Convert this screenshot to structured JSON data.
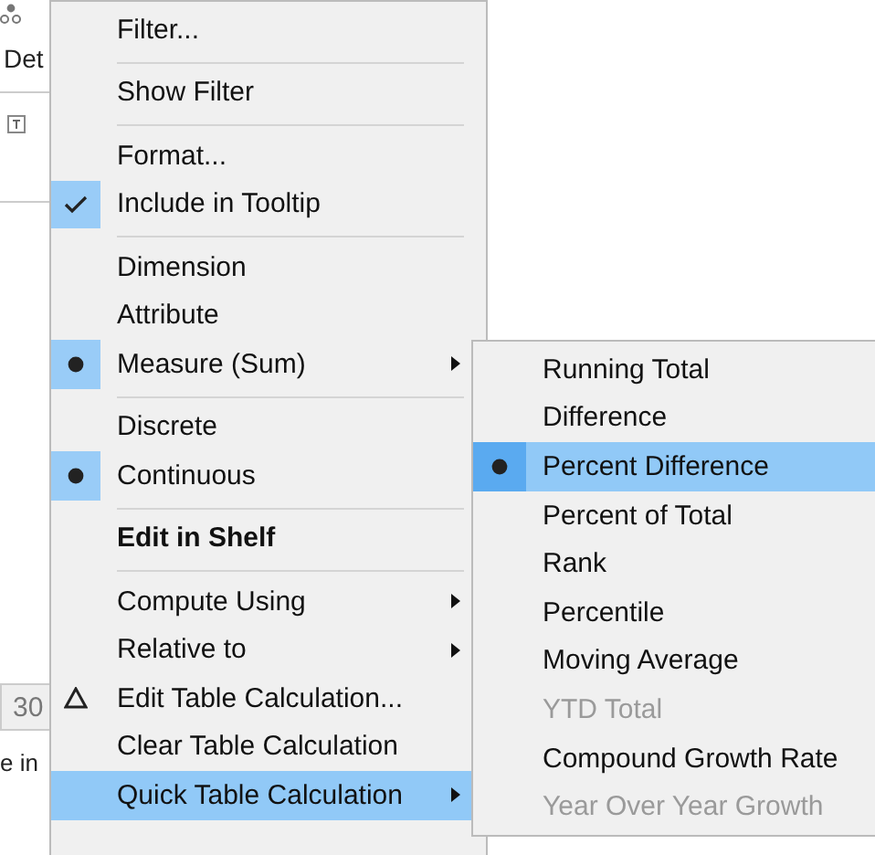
{
  "background": {
    "shelf_label": "Det",
    "cell_value": "30",
    "caption": "e in"
  },
  "menu": {
    "groups": [
      [
        {
          "label": "Filter...",
          "kind": "plain",
          "submenu": false,
          "bold": false,
          "highlighted": false
        }
      ],
      [
        {
          "label": "Show Filter",
          "kind": "plain",
          "submenu": false,
          "bold": false,
          "highlighted": false
        }
      ],
      [
        {
          "label": "Format...",
          "kind": "plain",
          "submenu": false,
          "bold": false,
          "highlighted": false
        },
        {
          "label": "Include in Tooltip",
          "kind": "check",
          "submenu": false,
          "bold": false,
          "highlighted": false
        }
      ],
      [
        {
          "label": "Dimension",
          "kind": "plain",
          "submenu": false,
          "bold": false,
          "highlighted": false
        },
        {
          "label": "Attribute",
          "kind": "plain",
          "submenu": false,
          "bold": false,
          "highlighted": false
        },
        {
          "label": "Measure (Sum)",
          "kind": "bullet",
          "submenu": true,
          "bold": false,
          "highlighted": false
        }
      ],
      [
        {
          "label": "Discrete",
          "kind": "plain",
          "submenu": false,
          "bold": false,
          "highlighted": false
        },
        {
          "label": "Continuous",
          "kind": "bullet",
          "submenu": false,
          "bold": false,
          "highlighted": false
        }
      ],
      [
        {
          "label": "Edit in Shelf",
          "kind": "plain",
          "submenu": false,
          "bold": true,
          "highlighted": false
        }
      ],
      [
        {
          "label": "Compute Using",
          "kind": "plain",
          "submenu": true,
          "bold": false,
          "highlighted": false
        },
        {
          "label": "Relative to",
          "kind": "plain",
          "submenu": true,
          "bold": false,
          "highlighted": false
        },
        {
          "label": "Edit Table Calculation...",
          "kind": "delta",
          "submenu": false,
          "bold": false,
          "highlighted": false
        },
        {
          "label": "Clear Table Calculation",
          "kind": "plain",
          "submenu": false,
          "bold": false,
          "highlighted": false
        },
        {
          "label": "Quick Table Calculation",
          "kind": "plain",
          "submenu": true,
          "bold": false,
          "highlighted": true
        }
      ]
    ]
  },
  "submenu": {
    "items": [
      {
        "label": "Running Total",
        "selected": false,
        "disabled": false
      },
      {
        "label": "Difference",
        "selected": false,
        "disabled": false
      },
      {
        "label": "Percent Difference",
        "selected": true,
        "disabled": false
      },
      {
        "label": "Percent of Total",
        "selected": false,
        "disabled": false
      },
      {
        "label": "Rank",
        "selected": false,
        "disabled": false
      },
      {
        "label": "Percentile",
        "selected": false,
        "disabled": false
      },
      {
        "label": "Moving Average",
        "selected": false,
        "disabled": false
      },
      {
        "label": "YTD Total",
        "selected": false,
        "disabled": true
      },
      {
        "label": "Compound Growth Rate",
        "selected": false,
        "disabled": false
      },
      {
        "label": "Year Over Year Growth",
        "selected": false,
        "disabled": true
      }
    ]
  }
}
